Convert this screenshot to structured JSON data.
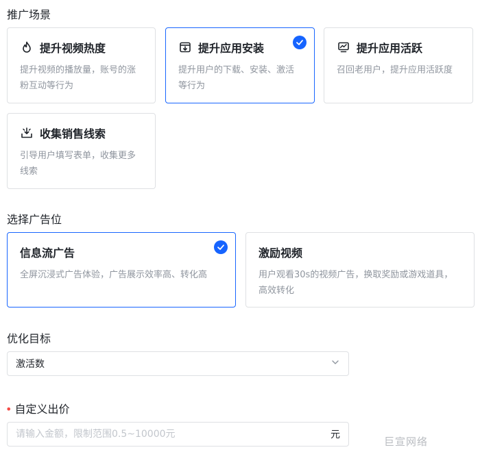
{
  "promo_scene": {
    "title": "推广场景",
    "options": [
      {
        "title": "提升视频热度",
        "desc": "提升视频的播放量，账号的涨粉互动等行为",
        "icon": "flame-icon",
        "selected": false
      },
      {
        "title": "提升应用安装",
        "desc": "提升用户的下载、安装、激活等行为",
        "icon": "download-box-icon",
        "selected": true
      },
      {
        "title": "提升应用活跃",
        "desc": "召回老用户，提升应用活跃度",
        "icon": "monitor-chart-icon",
        "selected": false
      },
      {
        "title": "收集销售线索",
        "desc": "引导用户填写表单，收集更多线索",
        "icon": "collect-tray-icon",
        "selected": false
      }
    ]
  },
  "ad_position": {
    "title": "选择广告位",
    "options": [
      {
        "title": "信息流广告",
        "desc": "全屏沉浸式广告体验，广告展示效率高、转化高",
        "selected": true
      },
      {
        "title": "激励视频",
        "desc": "用户观看30s的视频广告，换取奖励或游戏道具，高效转化",
        "selected": false
      }
    ]
  },
  "optimize_goal": {
    "title": "优化目标",
    "value": "激活数"
  },
  "custom_bid": {
    "required_mark": "•",
    "title": "自定义出价",
    "placeholder": "请输入金额，限制范围0.5~10000元",
    "unit": "元"
  },
  "watermark": "巨宣网络",
  "colors": {
    "accent": "#1664ff",
    "border": "#dee0e3",
    "muted": "#8f959e",
    "required": "#f54a45"
  }
}
